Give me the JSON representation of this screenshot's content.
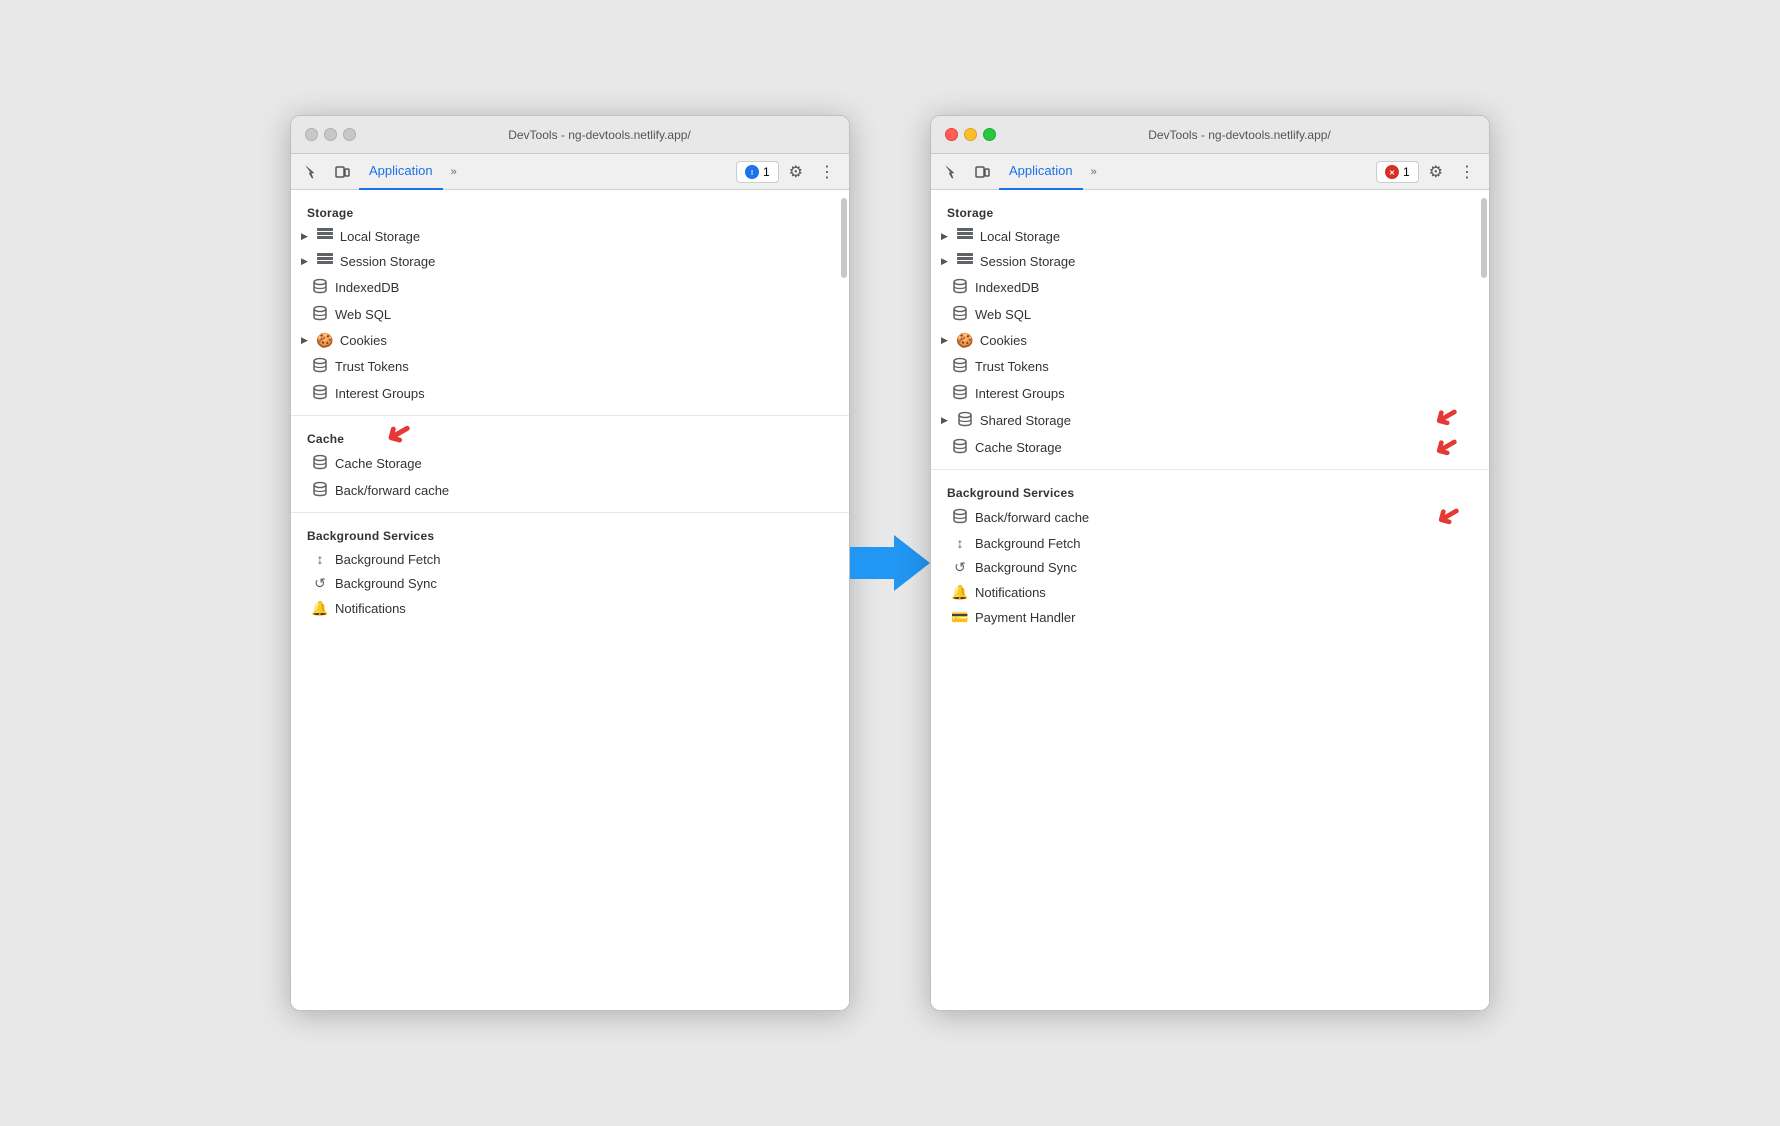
{
  "left_window": {
    "title": "DevTools - ng-devtools.netlify.app/",
    "tab_label": "Application",
    "badge_count": "1",
    "storage_header": "Storage",
    "storage_items": [
      {
        "label": "Local Storage",
        "icon": "grid",
        "has_arrow": true
      },
      {
        "label": "Session Storage",
        "icon": "grid",
        "has_arrow": true
      },
      {
        "label": "IndexedDB",
        "icon": "db"
      },
      {
        "label": "Web SQL",
        "icon": "db"
      },
      {
        "label": "Cookies",
        "icon": "cookie",
        "has_arrow": true
      },
      {
        "label": "Trust Tokens",
        "icon": "db"
      },
      {
        "label": "Interest Groups",
        "icon": "db"
      }
    ],
    "cache_header": "Cache",
    "cache_items": [
      {
        "label": "Cache Storage",
        "icon": "db"
      },
      {
        "label": "Back/forward cache",
        "icon": "db"
      }
    ],
    "bg_header": "Background Services",
    "bg_items": [
      {
        "label": "Background Fetch",
        "icon": "arrows"
      },
      {
        "label": "Background Sync",
        "icon": "sync"
      },
      {
        "label": "Notifications",
        "icon": "bell"
      }
    ]
  },
  "right_window": {
    "title": "DevTools - ng-devtools.netlify.app/",
    "tab_label": "Application",
    "badge_count": "1",
    "storage_header": "Storage",
    "storage_items": [
      {
        "label": "Local Storage",
        "icon": "grid",
        "has_arrow": true
      },
      {
        "label": "Session Storage",
        "icon": "grid",
        "has_arrow": true
      },
      {
        "label": "IndexedDB",
        "icon": "db"
      },
      {
        "label": "Web SQL",
        "icon": "db"
      },
      {
        "label": "Cookies",
        "icon": "cookie",
        "has_arrow": true
      },
      {
        "label": "Trust Tokens",
        "icon": "db"
      },
      {
        "label": "Interest Groups",
        "icon": "db"
      },
      {
        "label": "Shared Storage",
        "icon": "db",
        "has_arrow": true
      },
      {
        "label": "Cache Storage",
        "icon": "db"
      }
    ],
    "bg_header": "Background Services",
    "bg_items": [
      {
        "label": "Back/forward cache",
        "icon": "db"
      },
      {
        "label": "Background Fetch",
        "icon": "arrows"
      },
      {
        "label": "Background Sync",
        "icon": "sync"
      },
      {
        "label": "Notifications",
        "icon": "bell"
      },
      {
        "label": "Payment Handler",
        "icon": "card"
      }
    ]
  }
}
